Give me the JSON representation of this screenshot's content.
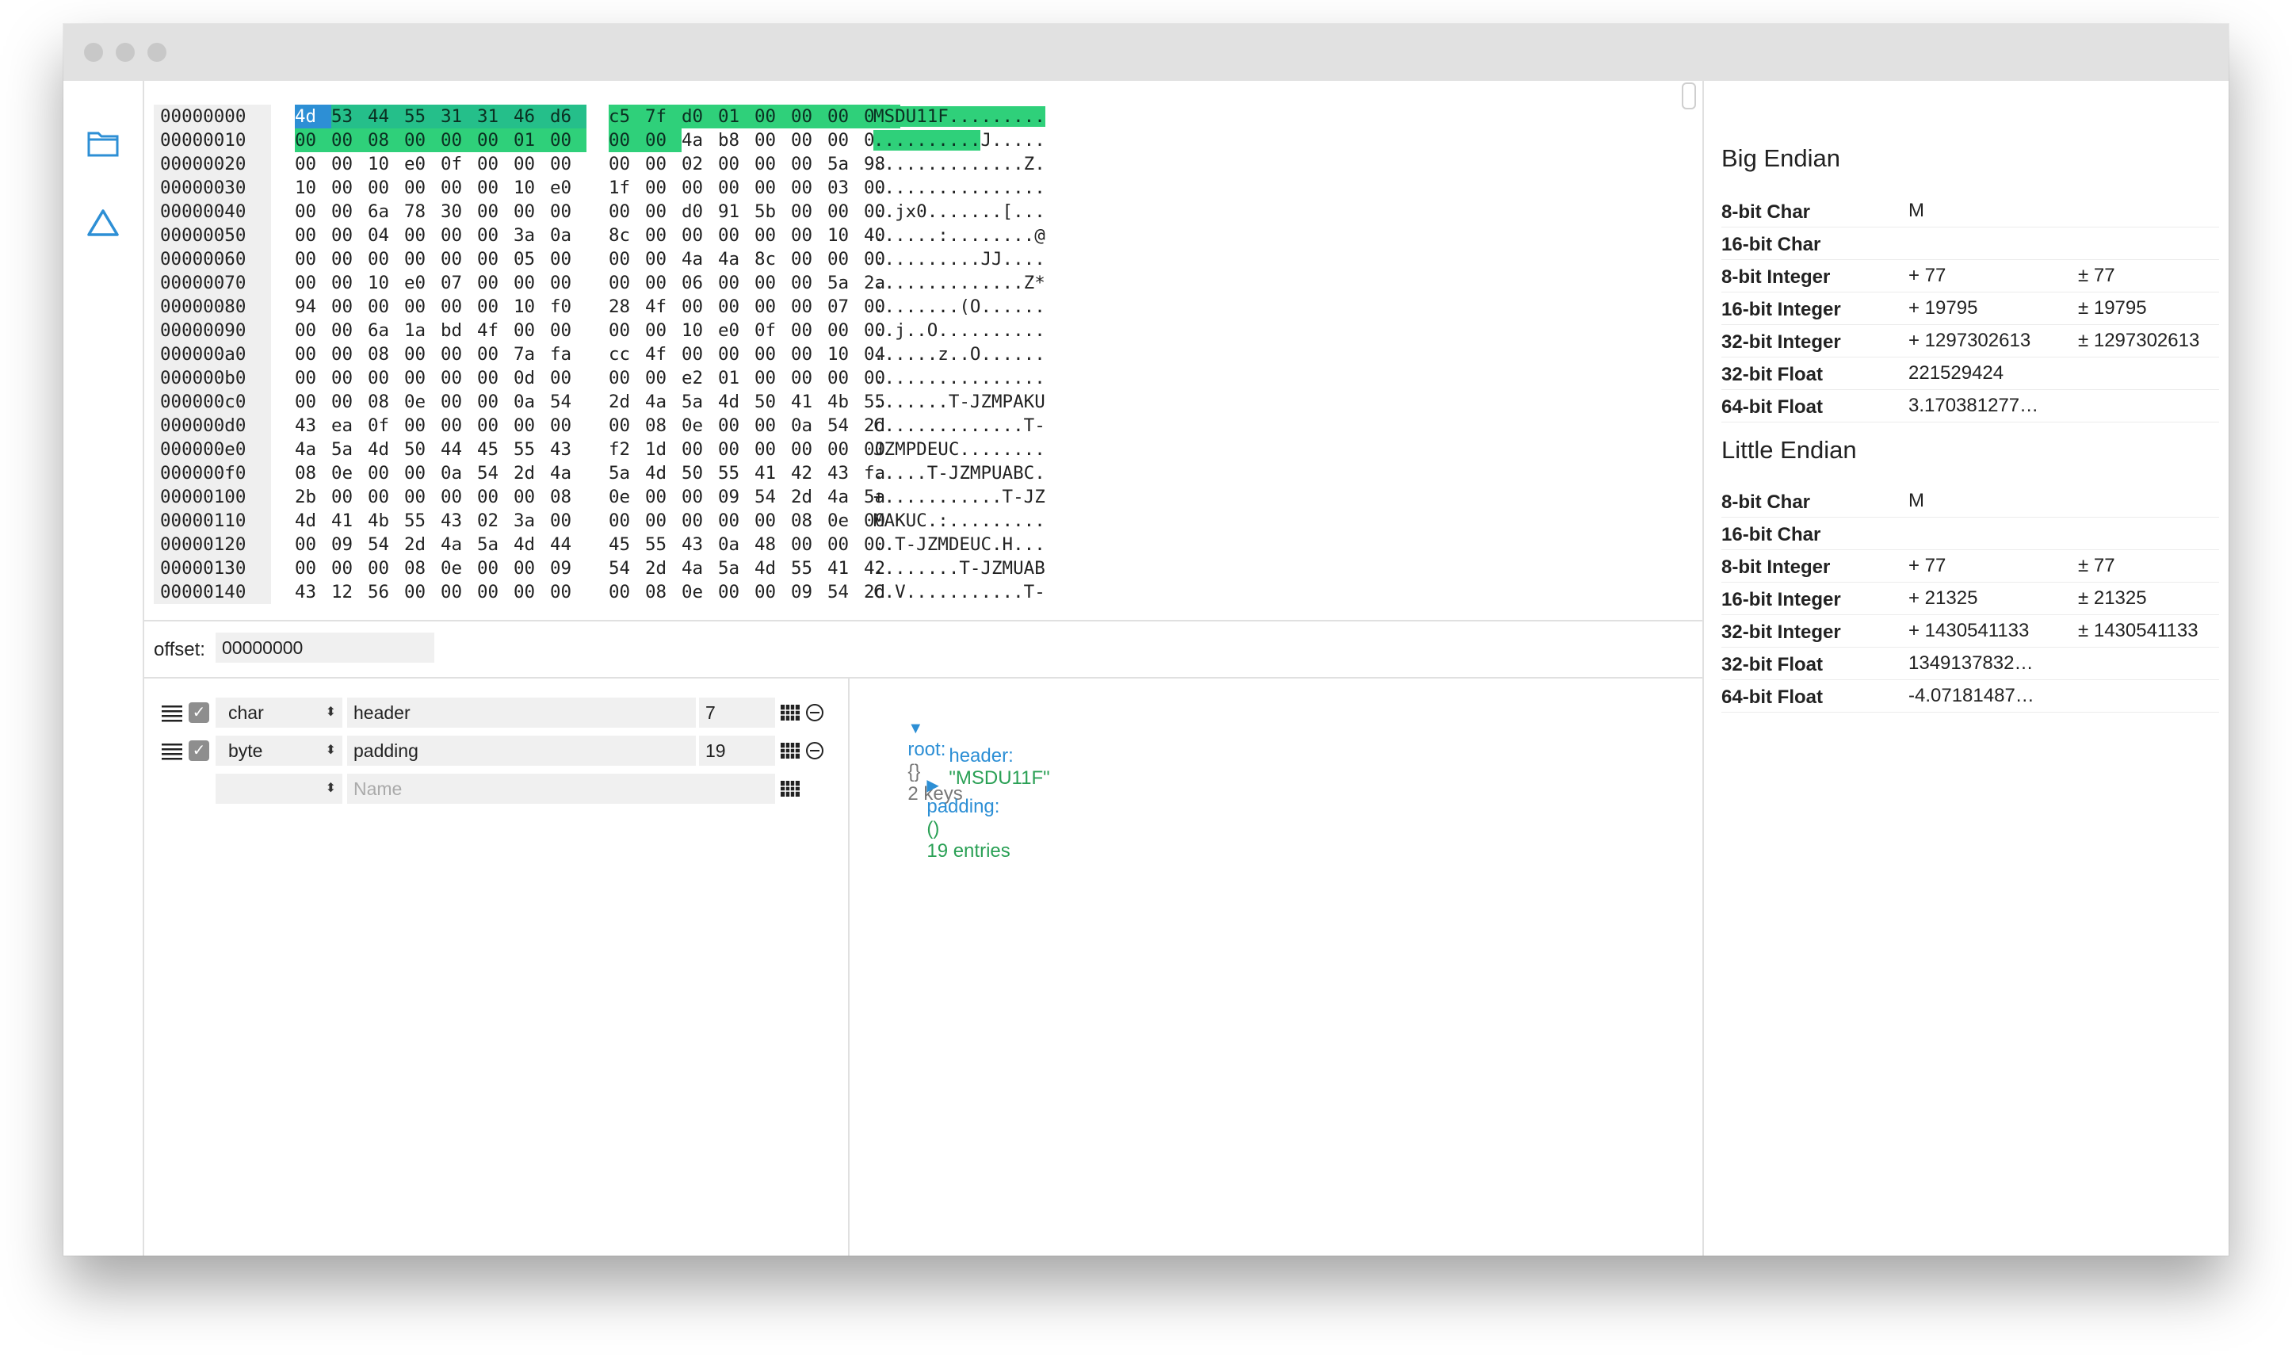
{
  "hex": {
    "offsets": [
      "00000000",
      "00000010",
      "00000020",
      "00000030",
      "00000040",
      "00000050",
      "00000060",
      "00000070",
      "00000080",
      "00000090",
      "000000a0",
      "000000b0",
      "000000c0",
      "000000d0",
      "000000e0",
      "000000f0",
      "00000100",
      "00000110",
      "00000120",
      "00000130",
      "00000140"
    ],
    "rows": [
      [
        "4d",
        "53",
        "44",
        "55",
        "31",
        "31",
        "46",
        "d6",
        "c5",
        "7f",
        "d0",
        "01",
        "00",
        "00",
        "00",
        "00"
      ],
      [
        "00",
        "00",
        "08",
        "00",
        "00",
        "00",
        "01",
        "00",
        "00",
        "00",
        "4a",
        "b8",
        "00",
        "00",
        "00",
        "00"
      ],
      [
        "00",
        "00",
        "10",
        "e0",
        "0f",
        "00",
        "00",
        "00",
        "00",
        "00",
        "02",
        "00",
        "00",
        "00",
        "5a",
        "98"
      ],
      [
        "10",
        "00",
        "00",
        "00",
        "00",
        "00",
        "10",
        "e0",
        "1f",
        "00",
        "00",
        "00",
        "00",
        "00",
        "03",
        "00"
      ],
      [
        "00",
        "00",
        "6a",
        "78",
        "30",
        "00",
        "00",
        "00",
        "00",
        "00",
        "d0",
        "91",
        "5b",
        "00",
        "00",
        "00"
      ],
      [
        "00",
        "00",
        "04",
        "00",
        "00",
        "00",
        "3a",
        "0a",
        "8c",
        "00",
        "00",
        "00",
        "00",
        "00",
        "10",
        "40"
      ],
      [
        "00",
        "00",
        "00",
        "00",
        "00",
        "00",
        "05",
        "00",
        "00",
        "00",
        "4a",
        "4a",
        "8c",
        "00",
        "00",
        "00"
      ],
      [
        "00",
        "00",
        "10",
        "e0",
        "07",
        "00",
        "00",
        "00",
        "00",
        "00",
        "06",
        "00",
        "00",
        "00",
        "5a",
        "2a"
      ],
      [
        "94",
        "00",
        "00",
        "00",
        "00",
        "00",
        "10",
        "f0",
        "28",
        "4f",
        "00",
        "00",
        "00",
        "00",
        "07",
        "00"
      ],
      [
        "00",
        "00",
        "6a",
        "1a",
        "bd",
        "4f",
        "00",
        "00",
        "00",
        "00",
        "10",
        "e0",
        "0f",
        "00",
        "00",
        "00"
      ],
      [
        "00",
        "00",
        "08",
        "00",
        "00",
        "00",
        "7a",
        "fa",
        "cc",
        "4f",
        "00",
        "00",
        "00",
        "00",
        "10",
        "04"
      ],
      [
        "00",
        "00",
        "00",
        "00",
        "00",
        "00",
        "0d",
        "00",
        "00",
        "00",
        "e2",
        "01",
        "00",
        "00",
        "00",
        "00"
      ],
      [
        "00",
        "00",
        "08",
        "0e",
        "00",
        "00",
        "0a",
        "54",
        "2d",
        "4a",
        "5a",
        "4d",
        "50",
        "41",
        "4b",
        "55"
      ],
      [
        "43",
        "ea",
        "0f",
        "00",
        "00",
        "00",
        "00",
        "00",
        "00",
        "08",
        "0e",
        "00",
        "00",
        "0a",
        "54",
        "2d"
      ],
      [
        "4a",
        "5a",
        "4d",
        "50",
        "44",
        "45",
        "55",
        "43",
        "f2",
        "1d",
        "00",
        "00",
        "00",
        "00",
        "00",
        "00"
      ],
      [
        "08",
        "0e",
        "00",
        "00",
        "0a",
        "54",
        "2d",
        "4a",
        "5a",
        "4d",
        "50",
        "55",
        "41",
        "42",
        "43",
        "fa"
      ],
      [
        "2b",
        "00",
        "00",
        "00",
        "00",
        "00",
        "00",
        "08",
        "0e",
        "00",
        "00",
        "09",
        "54",
        "2d",
        "4a",
        "5a"
      ],
      [
        "4d",
        "41",
        "4b",
        "55",
        "43",
        "02",
        "3a",
        "00",
        "00",
        "00",
        "00",
        "00",
        "00",
        "08",
        "0e",
        "00"
      ],
      [
        "00",
        "09",
        "54",
        "2d",
        "4a",
        "5a",
        "4d",
        "44",
        "45",
        "55",
        "43",
        "0a",
        "48",
        "00",
        "00",
        "00"
      ],
      [
        "00",
        "00",
        "00",
        "08",
        "0e",
        "00",
        "00",
        "09",
        "54",
        "2d",
        "4a",
        "5a",
        "4d",
        "55",
        "41",
        "42"
      ],
      [
        "43",
        "12",
        "56",
        "00",
        "00",
        "00",
        "00",
        "00",
        "00",
        "08",
        "0e",
        "00",
        "00",
        "09",
        "54",
        "2d"
      ]
    ],
    "ascii": [
      "MSDU11F.........",
      "..........J.....",
      "..............Z.",
      "................",
      "..jx0.......[...",
      "......:........@",
      "..........JJ....",
      "..............Z*",
      "........(O......",
      "..j..O..........",
      "......z..O......",
      "................",
      ".......T-JZMPAKU",
      "C.............T-",
      "JZMPDEUC........",
      ".....T-JZMPUABC.",
      "+...........T-JZ",
      "MAKUC.:.........",
      "..T-JZMDEUC.H...",
      "........T-JZMUAB",
      "C.V...........T-"
    ]
  },
  "offset_bar": {
    "label": "offset:",
    "value": "00000000"
  },
  "struct_fields": [
    {
      "type": "char",
      "name": "header",
      "size": "7"
    },
    {
      "type": "byte",
      "name": "padding",
      "size": "19"
    }
  ],
  "new_field": {
    "name_placeholder": "Name"
  },
  "tree": {
    "root_key": "root:",
    "root_brace": "{}",
    "root_summary": "2 keys",
    "header_key": "header:",
    "header_value": "\"MSDU11F\"",
    "padding_key": "padding:",
    "padding_brace": "()",
    "padding_summary": "19 entries"
  },
  "big_endian": {
    "title": "Big Endian",
    "rows": [
      {
        "label": "8-bit Char",
        "v1": "M",
        "v2": ""
      },
      {
        "label": "16-bit Char",
        "v1": "",
        "v2": ""
      },
      {
        "label": "8-bit Integer",
        "v1": "+ 77",
        "v2": "± 77"
      },
      {
        "label": "16-bit Integer",
        "v1": "+ 19795",
        "v2": "± 19795"
      },
      {
        "label": "32-bit Integer",
        "v1": "+ 1297302613",
        "v2": "± 1297302613"
      },
      {
        "label": "32-bit Float",
        "v1": "221529424",
        "v2": ""
      },
      {
        "label": "64-bit Float",
        "v1": "3.170381277…",
        "v2": ""
      }
    ]
  },
  "little_endian": {
    "title": "Little Endian",
    "rows": [
      {
        "label": "8-bit Char",
        "v1": "M",
        "v2": ""
      },
      {
        "label": "16-bit Char",
        "v1": "",
        "v2": ""
      },
      {
        "label": "8-bit Integer",
        "v1": "+ 77",
        "v2": "± 77"
      },
      {
        "label": "16-bit Integer",
        "v1": "+ 21325",
        "v2": "± 21325"
      },
      {
        "label": "32-bit Integer",
        "v1": "+ 1430541133",
        "v2": "± 1430541133"
      },
      {
        "label": "32-bit Float",
        "v1": "1349137832…",
        "v2": ""
      },
      {
        "label": "64-bit Float",
        "v1": "-4.07181487…",
        "v2": ""
      }
    ]
  },
  "icons": {
    "sidebar_folder": "folder-icon",
    "sidebar_triangle": "triangle-icon"
  },
  "colors": {
    "accent_blue": "#2d8fd5",
    "highlight_teal": "#25bf8a",
    "highlight_green": "#2fd07a",
    "string_green": "#2aa055"
  }
}
